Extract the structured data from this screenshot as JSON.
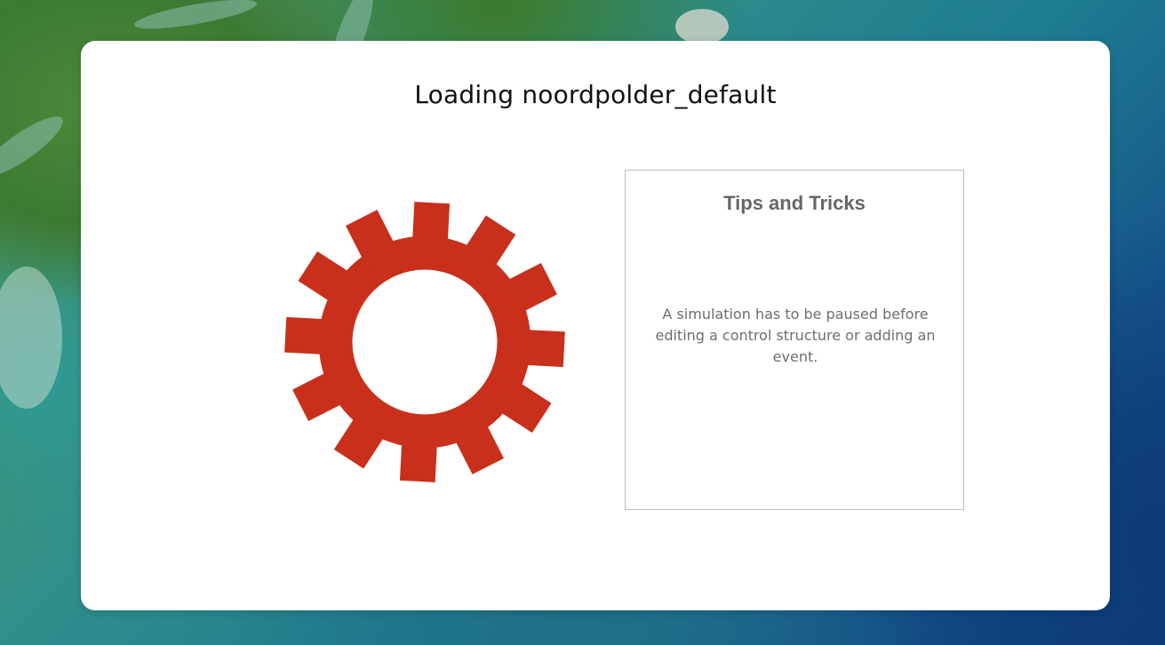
{
  "loading": {
    "title": "Loading noordpolder_default",
    "spinner_icon": "gear-icon",
    "spinner_color": "#c8301c"
  },
  "tips": {
    "heading": "Tips and Tricks",
    "text": "A simulation has to be paused before editing a control structure or adding an event."
  }
}
